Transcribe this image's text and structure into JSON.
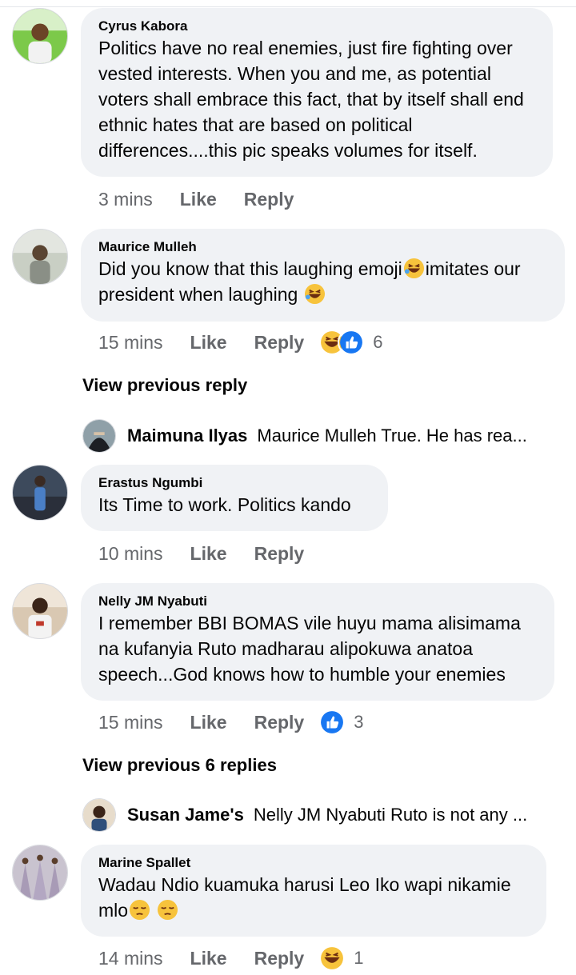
{
  "comments": [
    {
      "author": "Cyrus Kabora",
      "text": "Politics have no real enemies, just fire fighting over vested interests. When you and me, as potential voters shall embrace this fact, that by itself shall end ethnic hates that are based on political differences....this pic speaks volumes for itself.",
      "time": "3 mins",
      "like": "Like",
      "reply": "Reply"
    },
    {
      "author": "Maurice Mulleh",
      "text_part1": "Did you know that this laughing emoji",
      "text_part2": "imitates our president when laughing",
      "time": "15 mins",
      "like": "Like",
      "reply": "Reply",
      "reaction_count": "6"
    },
    {
      "author": "Erastus Ngumbi",
      "text": "Its Time to work. Politics kando",
      "time": "10 mins",
      "like": "Like",
      "reply": "Reply"
    },
    {
      "author": "Nelly JM Nyabuti",
      "text": "I remember BBI BOMAS vile huyu mama alisimama na kufanyia Ruto madharau alipokuwa anatoa speech...God knows how to humble your enemies",
      "time": "15 mins",
      "like": "Like",
      "reply": "Reply",
      "reaction_count": "3"
    },
    {
      "author": "Marine Spallet",
      "text": "Wadau Ndio kuamuka harusi Leo Iko wapi nikamie mlo",
      "time": "14 mins",
      "like": "Like",
      "reply": "Reply",
      "reaction_count": "1"
    }
  ],
  "threads": [
    {
      "view_previous": "View previous reply",
      "reply_author": "Maimuna Ilyas",
      "reply_preview": "Maurice Mulleh True. He has rea..."
    },
    {
      "view_previous": "View previous 6 replies",
      "reply_author": "Susan Jame's",
      "reply_preview": "Nelly JM Nyabuti Ruto is not any ..."
    }
  ],
  "icons": {
    "laugh": "laughing-emoji",
    "like": "like-reaction-icon",
    "pensive": "pensive-face-emoji"
  },
  "colors": {
    "bubble": "#f0f2f5",
    "meta": "#65676b",
    "like_blue": "#1877f2",
    "emoji_yellow": "#f7c33c"
  }
}
